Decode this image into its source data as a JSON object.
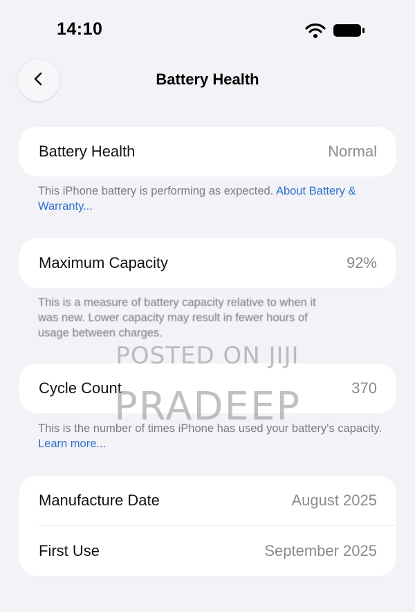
{
  "status_bar": {
    "time": "14:10",
    "icons": [
      "wifi-icon",
      "battery-icon"
    ]
  },
  "nav": {
    "back_icon": "chevron-left-icon",
    "title": "Battery Health"
  },
  "health": {
    "label": "Battery Health",
    "value": "Normal",
    "footnote_text": "This iPhone battery is performing as expected. ",
    "footnote_link": "About Battery & Warranty..."
  },
  "capacity": {
    "label": "Maximum Capacity",
    "value": "92%",
    "footnote_line1": "This is a measure of battery capacity relative to when it",
    "footnote_line2": "was new. Lower capacity may result in fewer hours of",
    "footnote_line3": "usage between charges."
  },
  "cycle": {
    "label": "Cycle Count",
    "value": "370",
    "footnote_text": "This is the number of times iPhone has used your battery's capacity. ",
    "footnote_link": "Learn more..."
  },
  "dates": {
    "manufacture_label": "Manufacture Date",
    "manufacture_value": "August 2025",
    "first_use_label": "First Use",
    "first_use_value": "September 2025"
  },
  "watermark": {
    "line1": "POSTED ON JIJI",
    "line2": "PRADEEP"
  },
  "colors": {
    "background": "#f2f2f7",
    "card": "#ffffff",
    "link": "#2f6fcf",
    "secondary_text": "#8a8a8e"
  }
}
